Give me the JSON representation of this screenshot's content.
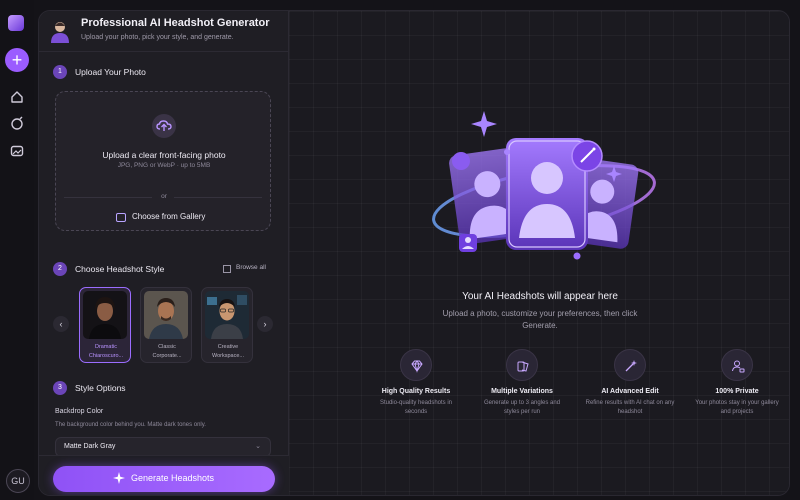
{
  "rail": {
    "avatar_initials": "GU"
  },
  "header": {
    "title": "Professional AI Headshot Generator",
    "subtitle": "Upload your photo, pick your style, and generate."
  },
  "step1": {
    "number": "1",
    "label": "Upload Your Photo",
    "upload_title": "Upload a clear front-facing photo",
    "upload_hint": "JPG, PNG or WebP · up to 5MB",
    "or": "or",
    "gallery_label": "Choose from Gallery"
  },
  "step2": {
    "number": "2",
    "label": "Choose Headshot Style",
    "browse_label": "Browse all",
    "styles": [
      {
        "label": "Dramatic Chiaroscuro",
        "line1": "Dramatic",
        "line2": "Chiaroscuro...",
        "selected": true
      },
      {
        "label": "Classic Corporate",
        "line1": "Classic",
        "line2": "Corporate...",
        "selected": false
      },
      {
        "label": "Creative Workspace",
        "line1": "Creative",
        "line2": "Workspace...",
        "selected": false
      }
    ]
  },
  "step3": {
    "number": "3",
    "label": "Style Options",
    "backdrop_label": "Backdrop Color",
    "backdrop_help": "The background color behind you. Matte dark tones only.",
    "backdrop_value": "Matte Dark Gray"
  },
  "generate_label": "Generate Headshots",
  "preview": {
    "title": "Your AI Headshots will appear here",
    "subtitle": "Upload a photo, customize your preferences, then click Generate."
  },
  "features": [
    {
      "icon": "diamond-icon",
      "title": "High Quality Results",
      "desc": "Studio-quality headshots in seconds"
    },
    {
      "icon": "layers-icon",
      "title": "Multiple Variations",
      "desc": "Generate up to 3 angles and styles per run"
    },
    {
      "icon": "magic-wand-icon",
      "title": "AI Advanced Edit",
      "desc": "Refine results with AI chat on any headshot"
    },
    {
      "icon": "user-lock-icon",
      "title": "100% Private",
      "desc": "Your photos stay in your gallery and projects"
    }
  ],
  "colors": {
    "accent": "#9b5cff",
    "background": "#141318",
    "panel": "#1f1e24"
  }
}
